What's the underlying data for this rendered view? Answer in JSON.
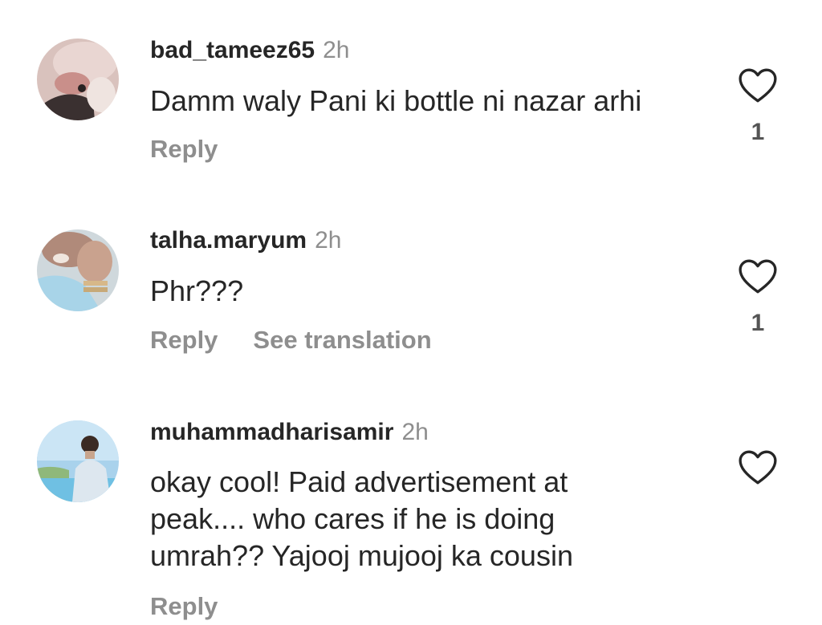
{
  "comments": [
    {
      "username": "bad_tameez65",
      "time": "2h",
      "text": "Damm waly Pani ki bottle ni nazar arhi",
      "reply_label": "Reply",
      "translate_label": "",
      "likes": "1",
      "avatar_icon": "avatar-photo"
    },
    {
      "username": "talha.maryum",
      "time": "2h",
      "text": "Phr???",
      "reply_label": "Reply",
      "translate_label": "See translation",
      "likes": "1",
      "avatar_icon": "avatar-photo"
    },
    {
      "username": "muhammadharisamir",
      "time": "2h",
      "text": "okay cool! Paid advertisement at peak.... who cares if he is doing umrah?? Yajooj mujooj ka cousin",
      "reply_label": "Reply",
      "translate_label": "",
      "likes": "",
      "avatar_icon": "avatar-photo"
    }
  ],
  "colors": {
    "text": "#262626",
    "muted": "#8e8e8e",
    "heart_outline": "#262626"
  }
}
